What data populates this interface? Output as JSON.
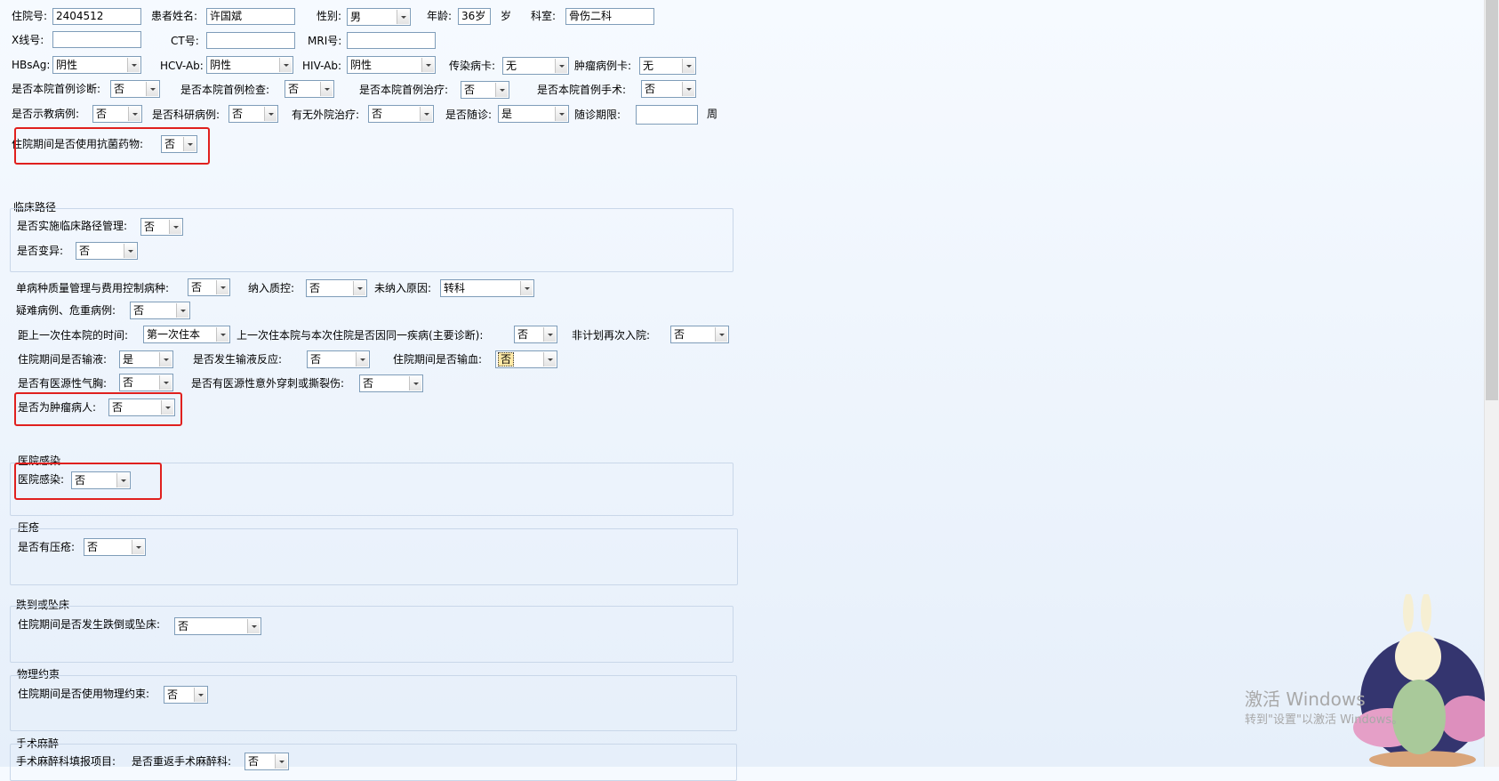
{
  "row1": {
    "inpatient_no_label": "住院号:",
    "inpatient_no": "2404512",
    "patient_name_label": "患者姓名:",
    "patient_name": "许国斌",
    "gender_label": "性别:",
    "gender": "男",
    "age_label": "年龄:",
    "age": "36岁",
    "age_unit": "岁",
    "dept_label": "科室:",
    "dept": "骨伤二科"
  },
  "row2": {
    "xray_label": "X线号:",
    "ct_label": "CT号:",
    "mri_label": "MRI号:"
  },
  "row3": {
    "hbsag_label": "HBsAg:",
    "hbsag": "阴性",
    "hcv_label": "HCV-Ab:",
    "hcv": "阴性",
    "hiv_label": "HIV-Ab:",
    "hiv": "阴性",
    "infect_card_label": "传染病卡:",
    "infect_card": "无",
    "tumor_card_label": "肿瘤病例卡:",
    "tumor_card": "无"
  },
  "row4": {
    "first_diag_label": "是否本院首例诊断:",
    "first_diag": "否",
    "first_exam_label": "是否本院首例检查:",
    "first_exam": "否",
    "first_treat_label": "是否本院首例治疗:",
    "first_treat": "否",
    "first_surg_label": "是否本院首例手术:",
    "first_surg": "否"
  },
  "row5": {
    "teaching_label": "是否示教病例:",
    "teaching": "否",
    "research_label": "是否科研病例:",
    "research": "否",
    "outside_label": "有无外院治疗:",
    "outside": "否",
    "followup_label": "是否随诊:",
    "followup": "是",
    "period_label": "随诊期限:",
    "period_unit": "周"
  },
  "row6": {
    "antibiotic_label": "住院期间是否使用抗菌药物:",
    "antibiotic": "否"
  },
  "clinical_path": {
    "title": "临床路径",
    "implement_label": "是否实施临床路径管理:",
    "implement": "否",
    "variation_label": "是否变异:",
    "variation": "否"
  },
  "row_quality": {
    "single_label": "单病种质量管理与费用控制病种:",
    "single": "否",
    "qc_label": "纳入质控:",
    "qc": "否",
    "reason_label": "未纳入原因:",
    "reason": "转科"
  },
  "row_difficult": {
    "label": "疑难病例、危重病例:",
    "value": "否"
  },
  "row_last": {
    "last_time_label": "距上一次住本院的时间:",
    "last_time": "第一次住本",
    "same_label": "上一次住本院与本次住院是否因同一疾病(主要诊断):",
    "same": "否",
    "unplanned_label": "非计划再次入院:",
    "unplanned": "否"
  },
  "row_infusion": {
    "infusion_label": "住院期间是否输液:",
    "infusion": "是",
    "reaction_label": "是否发生输液反应:",
    "reaction": "否",
    "blood_label": "住院期间是否输血:",
    "blood": "否"
  },
  "row_pneumo": {
    "pneumo_label": "是否有医源性气胸:",
    "pneumo": "否",
    "puncture_label": "是否有医源性意外穿刺或撕裂伤:",
    "puncture": "否"
  },
  "row_tumor": {
    "label": "是否为肿瘤病人:",
    "value": "否"
  },
  "hosp_infection": {
    "title": "医院感染",
    "label": "医院感染:",
    "value": "否"
  },
  "pressure": {
    "title": "压疮",
    "label": "是否有压疮:",
    "value": "否"
  },
  "fall": {
    "title": "跌到或坠床",
    "label": "住院期间是否发生跌倒或坠床:",
    "value": "否"
  },
  "restraint": {
    "title": "物理约束",
    "label": "住院期间是否使用物理约束:",
    "value": "否"
  },
  "anesthesia": {
    "title": "手术麻醉",
    "label": "手术麻醉科填报项目:",
    "return_label": "是否重返手术麻醉科:",
    "return_value": "否"
  },
  "watermark": {
    "line1": "激活 Windows",
    "line2": "转到\"设置\"以激活 Windows。"
  },
  "colors": {
    "highlight": "#e0201e",
    "focus": "#ffe9a6"
  }
}
